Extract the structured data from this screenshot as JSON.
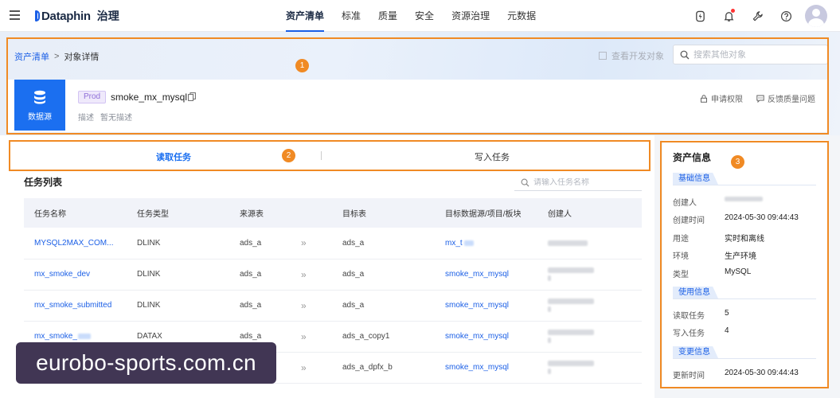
{
  "header": {
    "brand": "Dataphin",
    "module": "治理",
    "nav": [
      "资产清单",
      "标准",
      "质量",
      "安全",
      "资源治理",
      "元数据"
    ],
    "active_nav": 0,
    "icons": [
      "lightning-badge-icon",
      "bell-icon",
      "wrench-icon",
      "help-icon",
      "user-avatar"
    ]
  },
  "breadcrumb": {
    "root": "资产清单",
    "separator": ">",
    "current": "对象详情"
  },
  "hero": {
    "view_dev_object": "查看开发对象",
    "search_placeholder": "搜索其他对象"
  },
  "asset": {
    "tile_label": "数据源",
    "env_tag": "Prod",
    "name": "smoke_mx_mysql",
    "desc_label": "描述",
    "desc_value": "暂无描述",
    "apply_permission": "申请权限",
    "feedback": "反馈质量问题"
  },
  "tabs": {
    "read": "读取任务",
    "write": "写入任务",
    "active": "read"
  },
  "task_list": {
    "title": "任务列表",
    "search_placeholder": "请输入任务名称",
    "columns": [
      "任务名称",
      "任务类型",
      "来源表",
      "目标表",
      "目标数据源/项目/板块",
      "创建人"
    ],
    "rows": [
      {
        "name": "MYSQL2MAX_COM...",
        "type": "DLINK",
        "source": "ads_a",
        "arrow": "»",
        "target": "ads_a",
        "target_ds": "mx_t"
      },
      {
        "name": "mx_smoke_dev",
        "type": "DLINK",
        "source": "ads_a",
        "arrow": "»",
        "target": "ads_a",
        "target_ds": "smoke_mx_mysql"
      },
      {
        "name": "mx_smoke_submitted",
        "type": "DLINK",
        "source": "ads_a",
        "arrow": "»",
        "target": "ads_a",
        "target_ds": "smoke_mx_mysql"
      },
      {
        "name": "mx_smoke_",
        "type": "DATAX",
        "source": "ads_a",
        "arrow": "»",
        "target": "ads_a_copy1",
        "target_ds": "smoke_mx_mysql"
      },
      {
        "name": "",
        "type": "",
        "source": "",
        "arrow": "»",
        "target": "ads_a_dpfx_b",
        "target_ds": "smoke_mx_mysql"
      }
    ]
  },
  "asset_info": {
    "title": "资产信息",
    "basic": {
      "label": "基础信息",
      "items": [
        {
          "k": "创建人",
          "v": ""
        },
        {
          "k": "创建时间",
          "v": "2024-05-30 09:44:43"
        },
        {
          "k": "用途",
          "v": "实时和离线"
        },
        {
          "k": "环境",
          "v": "生产环境"
        },
        {
          "k": "类型",
          "v": "MySQL"
        }
      ]
    },
    "usage": {
      "label": "使用信息",
      "items": [
        {
          "k": "读取任务",
          "v": "5"
        },
        {
          "k": "写入任务",
          "v": "4"
        }
      ]
    },
    "change": {
      "label": "变更信息",
      "items": [
        {
          "k": "更新时间",
          "v": "2024-05-30 09:44:43"
        }
      ]
    }
  },
  "annotations": [
    "1",
    "2",
    "3"
  ],
  "watermark": "eurobo-sports.com.cn",
  "colors": {
    "accent": "#1b5fe6",
    "annotation": "#f08a24",
    "tile": "#1b6ff0"
  }
}
